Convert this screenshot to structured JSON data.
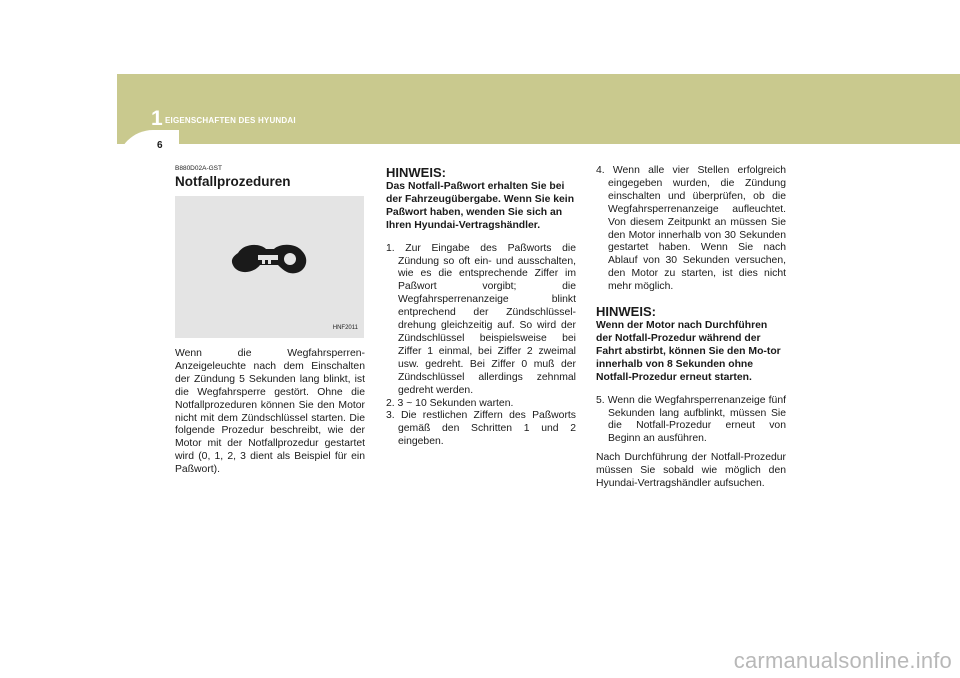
{
  "header": {
    "chapter_number": "1",
    "chapter_title": "EIGENSCHAFTEN DES HYUNDAI",
    "page_number": "6",
    "band_color": "#c9c98e"
  },
  "col1": {
    "section_code": "B880D02A-GST",
    "title": "Notfallprozeduren",
    "figure_code": "HNF2011",
    "figure_icon": "immobilizer-key-icon",
    "paragraph": "Wenn die Wegfahrsperren-Anzeigeleuchte nach dem Einschalten der Zündung 5 Sekunden lang blinkt, ist die Wegfahrsperre gestört. Ohne die Notfallprozeduren können Sie den Motor nicht mit dem Zündschlüssel starten. Die folgende Prozedur beschreibt, wie der Motor mit der Notfallprozedur gestartet wird (0, 1, 2, 3 dient als Beispiel für ein Paßwort)."
  },
  "col2": {
    "hinweis_heading": "HINWEIS:",
    "hinweis_bold": "Das Notfall-Paßwort erhalten Sie bei der Fahrzeugübergabe. Wenn Sie kein Paßwort haben, wenden Sie sich an Ihren Hyundai-Vertragshändler.",
    "steps": [
      "1. Zur Eingabe des Paßworts die Zündung so oft ein- und ausschalten, wie es die entsprechende Ziffer im Paßwort vorgibt; die Wegfahrsperrenanzeige blinkt entprechend der Zündschlüssel-drehung gleichzeitig auf. So wird der Zündschlüssel beispielsweise bei Ziffer 1 einmal, bei Ziffer 2 zweimal usw. gedreht. Bei Ziffer 0 muß der Zündschlüssel allerdings zehnmal gedreht werden.",
      "2. 3 ~ 10 Sekunden warten.",
      "3. Die restlichen Ziffern des Paßworts gemäß den Schritten 1 und 2 eingeben."
    ]
  },
  "col3": {
    "step4": "4. Wenn alle vier Stellen erfolgreich eingegeben wurden, die Zündung einschalten und überprüfen, ob die Wegfahrsperrenanzeige aufleuchtet. Von diesem Zeitpunkt an müssen Sie den Motor innerhalb von 30 Sekunden gestartet haben. Wenn Sie nach Ablauf von 30 Sekunden versuchen, den Motor zu starten, ist dies nicht mehr möglich.",
    "hinweis_heading": "HINWEIS:",
    "hinweis_bold": "Wenn der Motor nach Durchführen der Notfall-Prozedur während der Fahrt abstirbt, können Sie den Mo-tor innerhalb von 8 Sekunden ohne Notfall-Prozedur erneut starten.",
    "step5": "5. Wenn die Wegfahrsperrenanzeige fünf Sekunden lang aufblinkt, müssen Sie die Notfall-Prozedur erneut von Beginn an ausführen.",
    "closing": "Nach Durchführung der Notfall-Prozedur müssen Sie sobald wie möglich den Hyundai-Vertragshändler aufsuchen."
  },
  "watermark": "carmanualsonline.info"
}
